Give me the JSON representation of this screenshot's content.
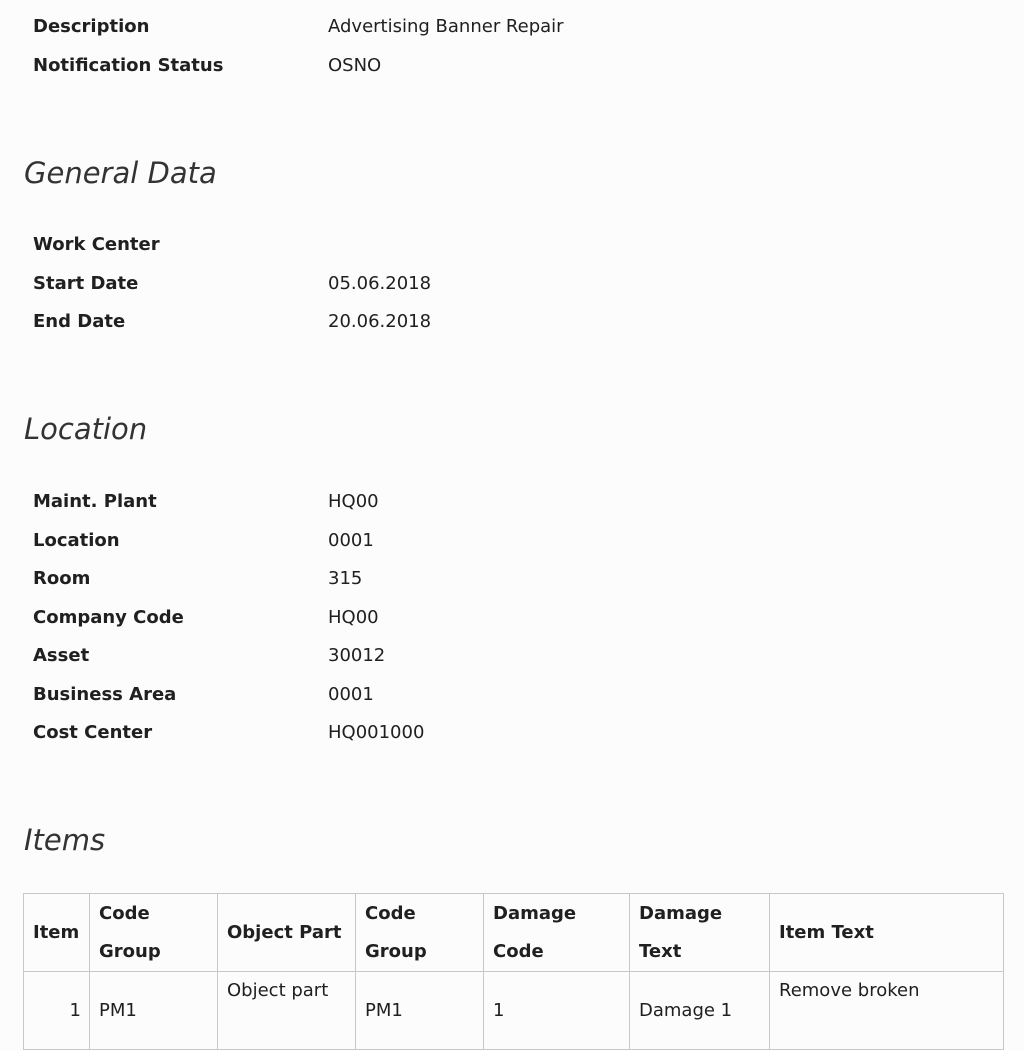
{
  "header_fields": [
    {
      "label": "Description",
      "value": "Advertising Banner Repair"
    },
    {
      "label": "Notification Status",
      "value": "OSNO"
    }
  ],
  "sections": {
    "general_data": {
      "title": "General Data",
      "fields": [
        {
          "label": "Work Center",
          "value": ""
        },
        {
          "label": "Start Date",
          "value": "05.06.2018"
        },
        {
          "label": "End Date",
          "value": "20.06.2018"
        }
      ]
    },
    "location": {
      "title": "Location",
      "fields": [
        {
          "label": "Maint. Plant",
          "value": "HQ00"
        },
        {
          "label": "Location",
          "value": "0001"
        },
        {
          "label": "Room",
          "value": "315"
        },
        {
          "label": "Company Code",
          "value": "HQ00"
        },
        {
          "label": "Asset",
          "value": "30012"
        },
        {
          "label": "Business Area",
          "value": "0001"
        },
        {
          "label": "Cost Center",
          "value": "HQ001000"
        }
      ]
    },
    "items": {
      "title": "Items",
      "columns": {
        "item": "Item",
        "code_group_1_line1": "Code",
        "code_group_1_line2": "Group",
        "object_part": "Object Part",
        "code_group_2_line1": "Code",
        "code_group_2_line2": "Group",
        "damage_code_line1": "Damage",
        "damage_code_line2": "Code",
        "damage_text_line1": "Damage",
        "damage_text_line2": "Text",
        "item_text": "Item Text"
      },
      "rows": [
        {
          "item": "1",
          "code_group_1": "PM1",
          "object_part": "Object part",
          "code_group_2": "PM1",
          "damage_code": "1",
          "damage_text": "Damage 1",
          "item_text": "Remove broken"
        }
      ]
    }
  }
}
